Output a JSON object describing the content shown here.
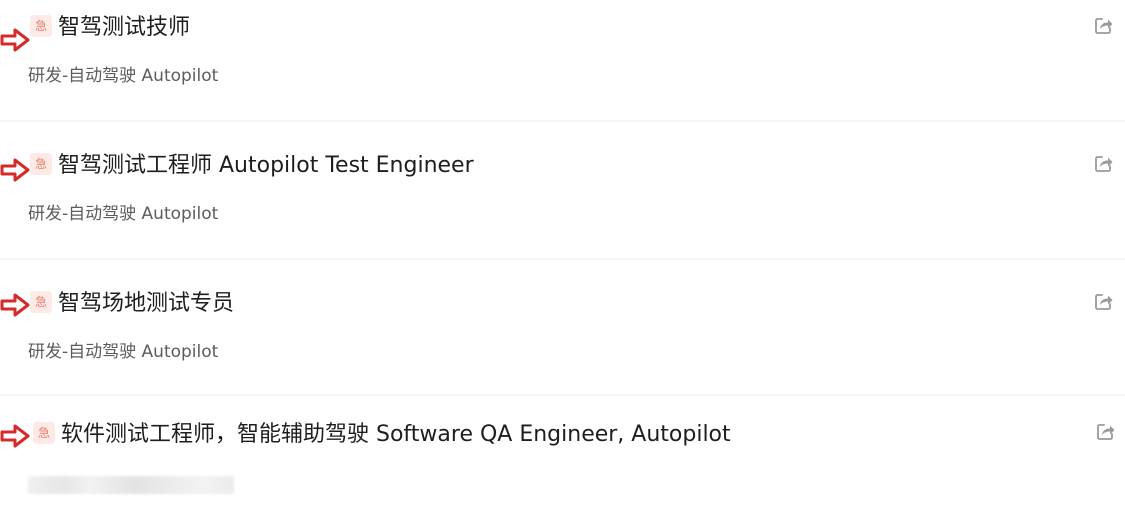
{
  "jobs": [
    {
      "title": "智驾测试技师",
      "department": "研发-自动驾驶 Autopilot",
      "urgent_badge": "急"
    },
    {
      "title": "智驾测试工程师 Autopilot Test Engineer",
      "department": "研发-自动驾驶 Autopilot",
      "urgent_badge": "急"
    },
    {
      "title": "智驾场地测试专员",
      "department": "研发-自动驾驶 Autopilot",
      "urgent_badge": "急"
    },
    {
      "title": "软件测试工程师，智能辅助驾驶 Software QA Engineer, Autopilot",
      "department": "",
      "urgent_badge": "急"
    }
  ],
  "icons": {
    "arrow": "red-arrow-icon",
    "share": "share-icon"
  },
  "colors": {
    "arrow": "#d42a2a",
    "badge_bg": "#fde9e6",
    "badge_text": "#e6826e",
    "title": "#1e1e1e",
    "department": "#5c5c5c",
    "share": "#9a9a9a"
  }
}
